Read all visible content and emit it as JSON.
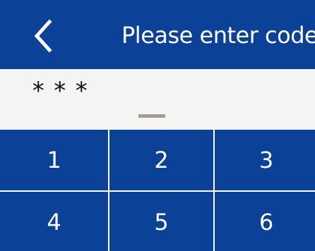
{
  "header": {
    "back_icon": "chevron-left-icon",
    "title": "Please enter code"
  },
  "entry": {
    "masked_value": "***"
  },
  "keypad": {
    "keys": [
      "1",
      "2",
      "3",
      "4",
      "5",
      "6"
    ]
  },
  "colors": {
    "primary": "#0b4197",
    "entry_background": "#f4f4f2",
    "cursor": "#a49b93",
    "text_light": "#ffffff"
  }
}
